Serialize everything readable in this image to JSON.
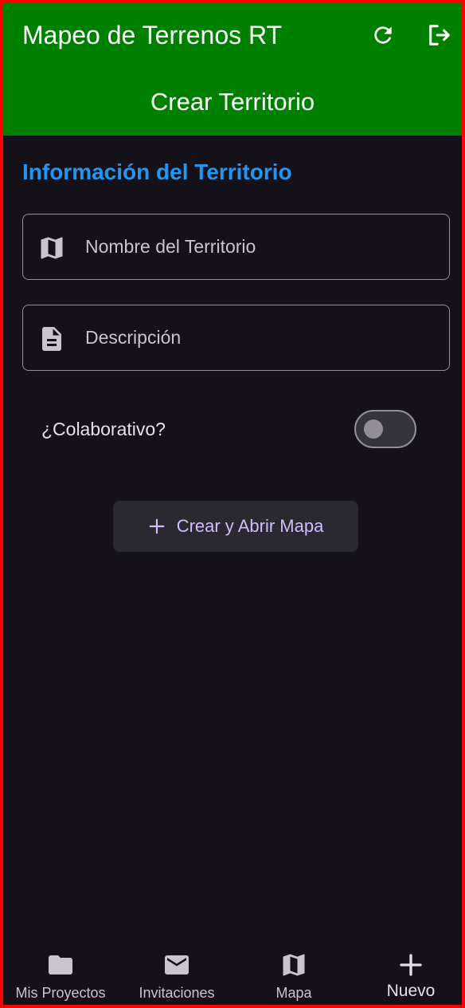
{
  "app_bar": {
    "title": "Mapeo de Terrenos RT",
    "subtitle": "Crear Territorio",
    "background_color": "#008000",
    "actions": [
      {
        "icon": "refresh-icon"
      },
      {
        "icon": "logout-icon"
      }
    ]
  },
  "form": {
    "section_title": "Información del Territorio",
    "section_title_color": "#2196f3",
    "name_field": {
      "icon": "map-icon",
      "placeholder": "Nombre del Territorio",
      "value": ""
    },
    "description_field": {
      "icon": "document-icon",
      "placeholder": "Descripción",
      "value": ""
    },
    "collaborative": {
      "label": "¿Colaborativo?",
      "checked": false
    },
    "submit_button": {
      "icon": "plus-icon",
      "label": "Crear y Abrir Mapa",
      "label_color": "#d0bcff"
    }
  },
  "bottom_nav": {
    "items": [
      {
        "icon": "folder-icon",
        "label": "Mis Proyectos",
        "active": false
      },
      {
        "icon": "mail-icon",
        "label": "Invitaciones",
        "active": false
      },
      {
        "icon": "map-icon",
        "label": "Mapa",
        "active": false
      },
      {
        "icon": "plus-icon",
        "label": "Nuevo",
        "active": true
      }
    ]
  },
  "colors": {
    "background": "#141218",
    "frame_border": "#ff0000"
  }
}
